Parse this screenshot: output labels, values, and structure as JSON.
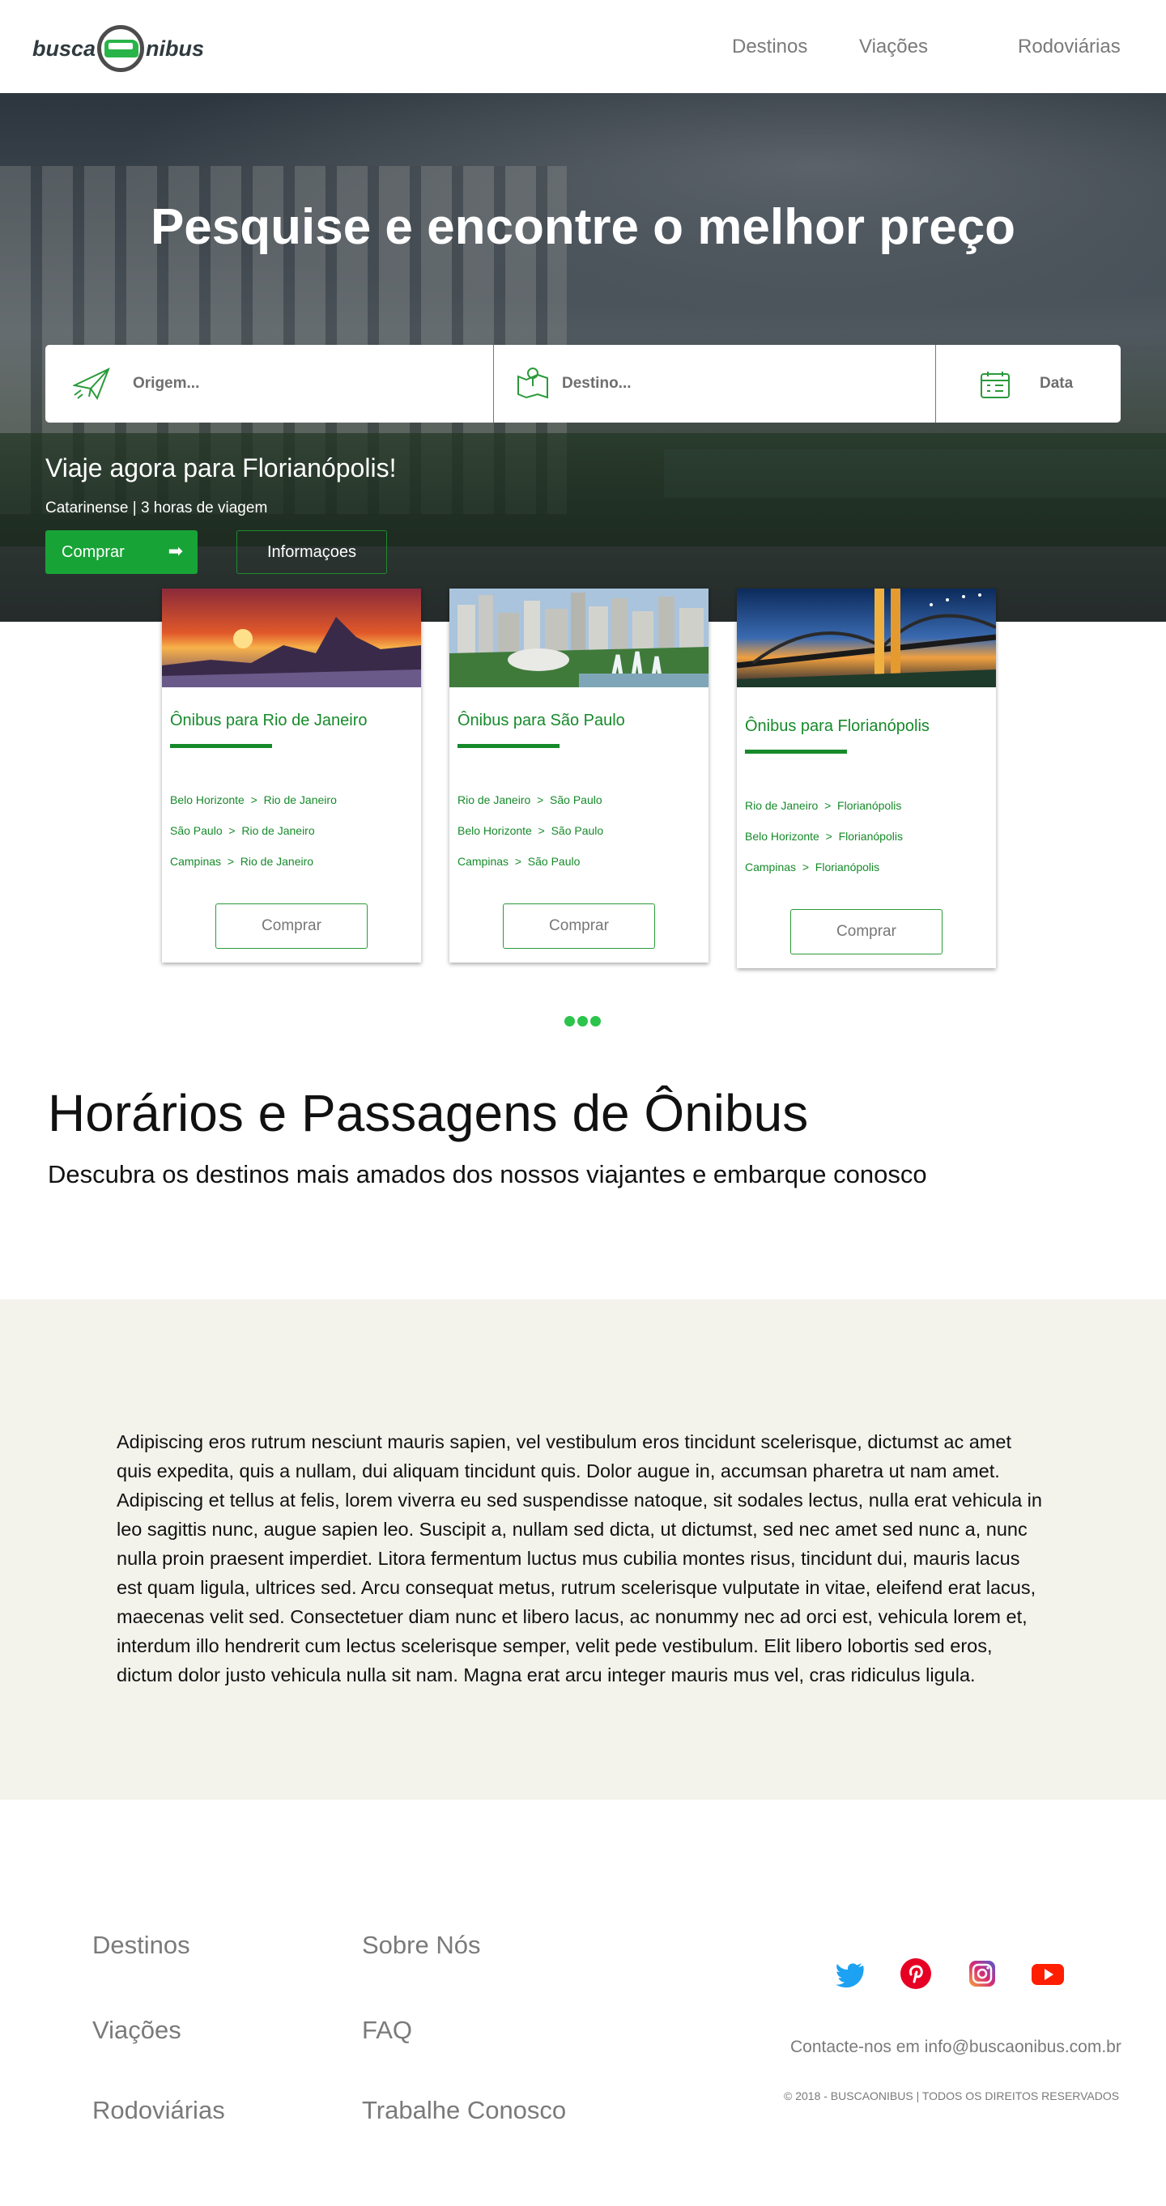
{
  "header": {
    "logo_left": "busca",
    "logo_right": "nibus",
    "nav": [
      "Destinos",
      "Viações",
      "Rodoviárias"
    ]
  },
  "hero": {
    "title": "Pesquise e encontre o melhor preço",
    "search": {
      "origin_placeholder": "Origem...",
      "destination_placeholder": "Destino...",
      "date_label": "Data"
    },
    "promo": {
      "title": "Viaje agora para Florianópolis!",
      "company": "Catarinense",
      "separator": "|",
      "duration": "3 horas de viagem",
      "buy_label": "Comprar",
      "info_label": "Informaçoes"
    }
  },
  "cards": [
    {
      "title": "Ônibus para Rio de Janeiro",
      "routes": [
        {
          "from": "Belo Horizonte",
          "to": "Rio de Janeiro"
        },
        {
          "from": "São Paulo",
          "to": "Rio de Janeiro"
        },
        {
          "from": "Campinas",
          "to": "Rio de Janeiro"
        }
      ],
      "button": "Comprar"
    },
    {
      "title": "Ônibus para São Paulo",
      "routes": [
        {
          "from": "Rio de Janeiro",
          "to": "São Paulo"
        },
        {
          "from": "Belo Horizonte",
          "to": "São Paulo"
        },
        {
          "from": "Campinas",
          "to": "São Paulo"
        }
      ],
      "button": "Comprar"
    },
    {
      "title": "Ônibus para Florianópolis",
      "routes": [
        {
          "from": "Rio de Janeiro",
          "to": "Florianópolis"
        },
        {
          "from": "Belo Horizonte",
          "to": "Florianópolis"
        },
        {
          "from": "Campinas",
          "to": "Florianópolis"
        }
      ],
      "button": "Comprar"
    }
  ],
  "route_separator": ">",
  "section": {
    "title": "Horários e Passagens de Ônibus",
    "subtitle": "Descubra os destinos mais amados dos nossos viajantes e embarque conosco"
  },
  "body_text": "Adipiscing eros rutrum nesciunt mauris sapien, vel vestibulum eros tincidunt scelerisque, dictumst ac amet quis expedita, quis a nullam, dui aliquam tincidunt quis. Dolor augue in, accumsan pharetra ut nam amet. Adipiscing et tellus at felis, lorem viverra eu sed suspendisse natoque, sit sodales lectus, nulla erat vehicula in leo sagittis nunc, augue sapien leo. Suscipit a, nullam sed dicta, ut dictumst, sed nec amet sed nunc a, nunc nulla proin praesent imperdiet. Litora fermentum luctus mus cubilia montes risus, tincidunt dui, mauris lacus est quam ligula, ultrices sed. Arcu consequat metus, rutrum scelerisque vulputate in vitae, eleifend erat lacus, maecenas velit sed. Consectetuer diam nunc et libero lacus, ac nonummy nec ad orci est, vehicula lorem et, interdum illo hendrerit cum lectus scelerisque semper, velit pede vestibulum. Elit libero lobortis sed eros, dictum dolor justo vehicula nulla sit nam. Magna erat arcu integer mauris mus vel, cras ridiculus ligula.",
  "footer": {
    "col1": [
      "Destinos",
      "Viações",
      "Rodoviárias"
    ],
    "col2": [
      "Sobre Nós",
      "FAQ",
      "Trabalhe Conosco"
    ],
    "social": [
      "twitter-icon",
      "pinterest-icon",
      "instagram-icon",
      "youtube-icon"
    ],
    "contact": "Contacte-nos em info@buscaonibus.com.br",
    "copyright": "© 2018 - BUSCAONIBUS | TODOS OS DIREITOS RESERVADOS"
  },
  "colors": {
    "brand_green": "#18a337",
    "link_green": "#168a2a",
    "band_bg": "#f3f3ec",
    "nav_gray": "#7a7a7a"
  }
}
